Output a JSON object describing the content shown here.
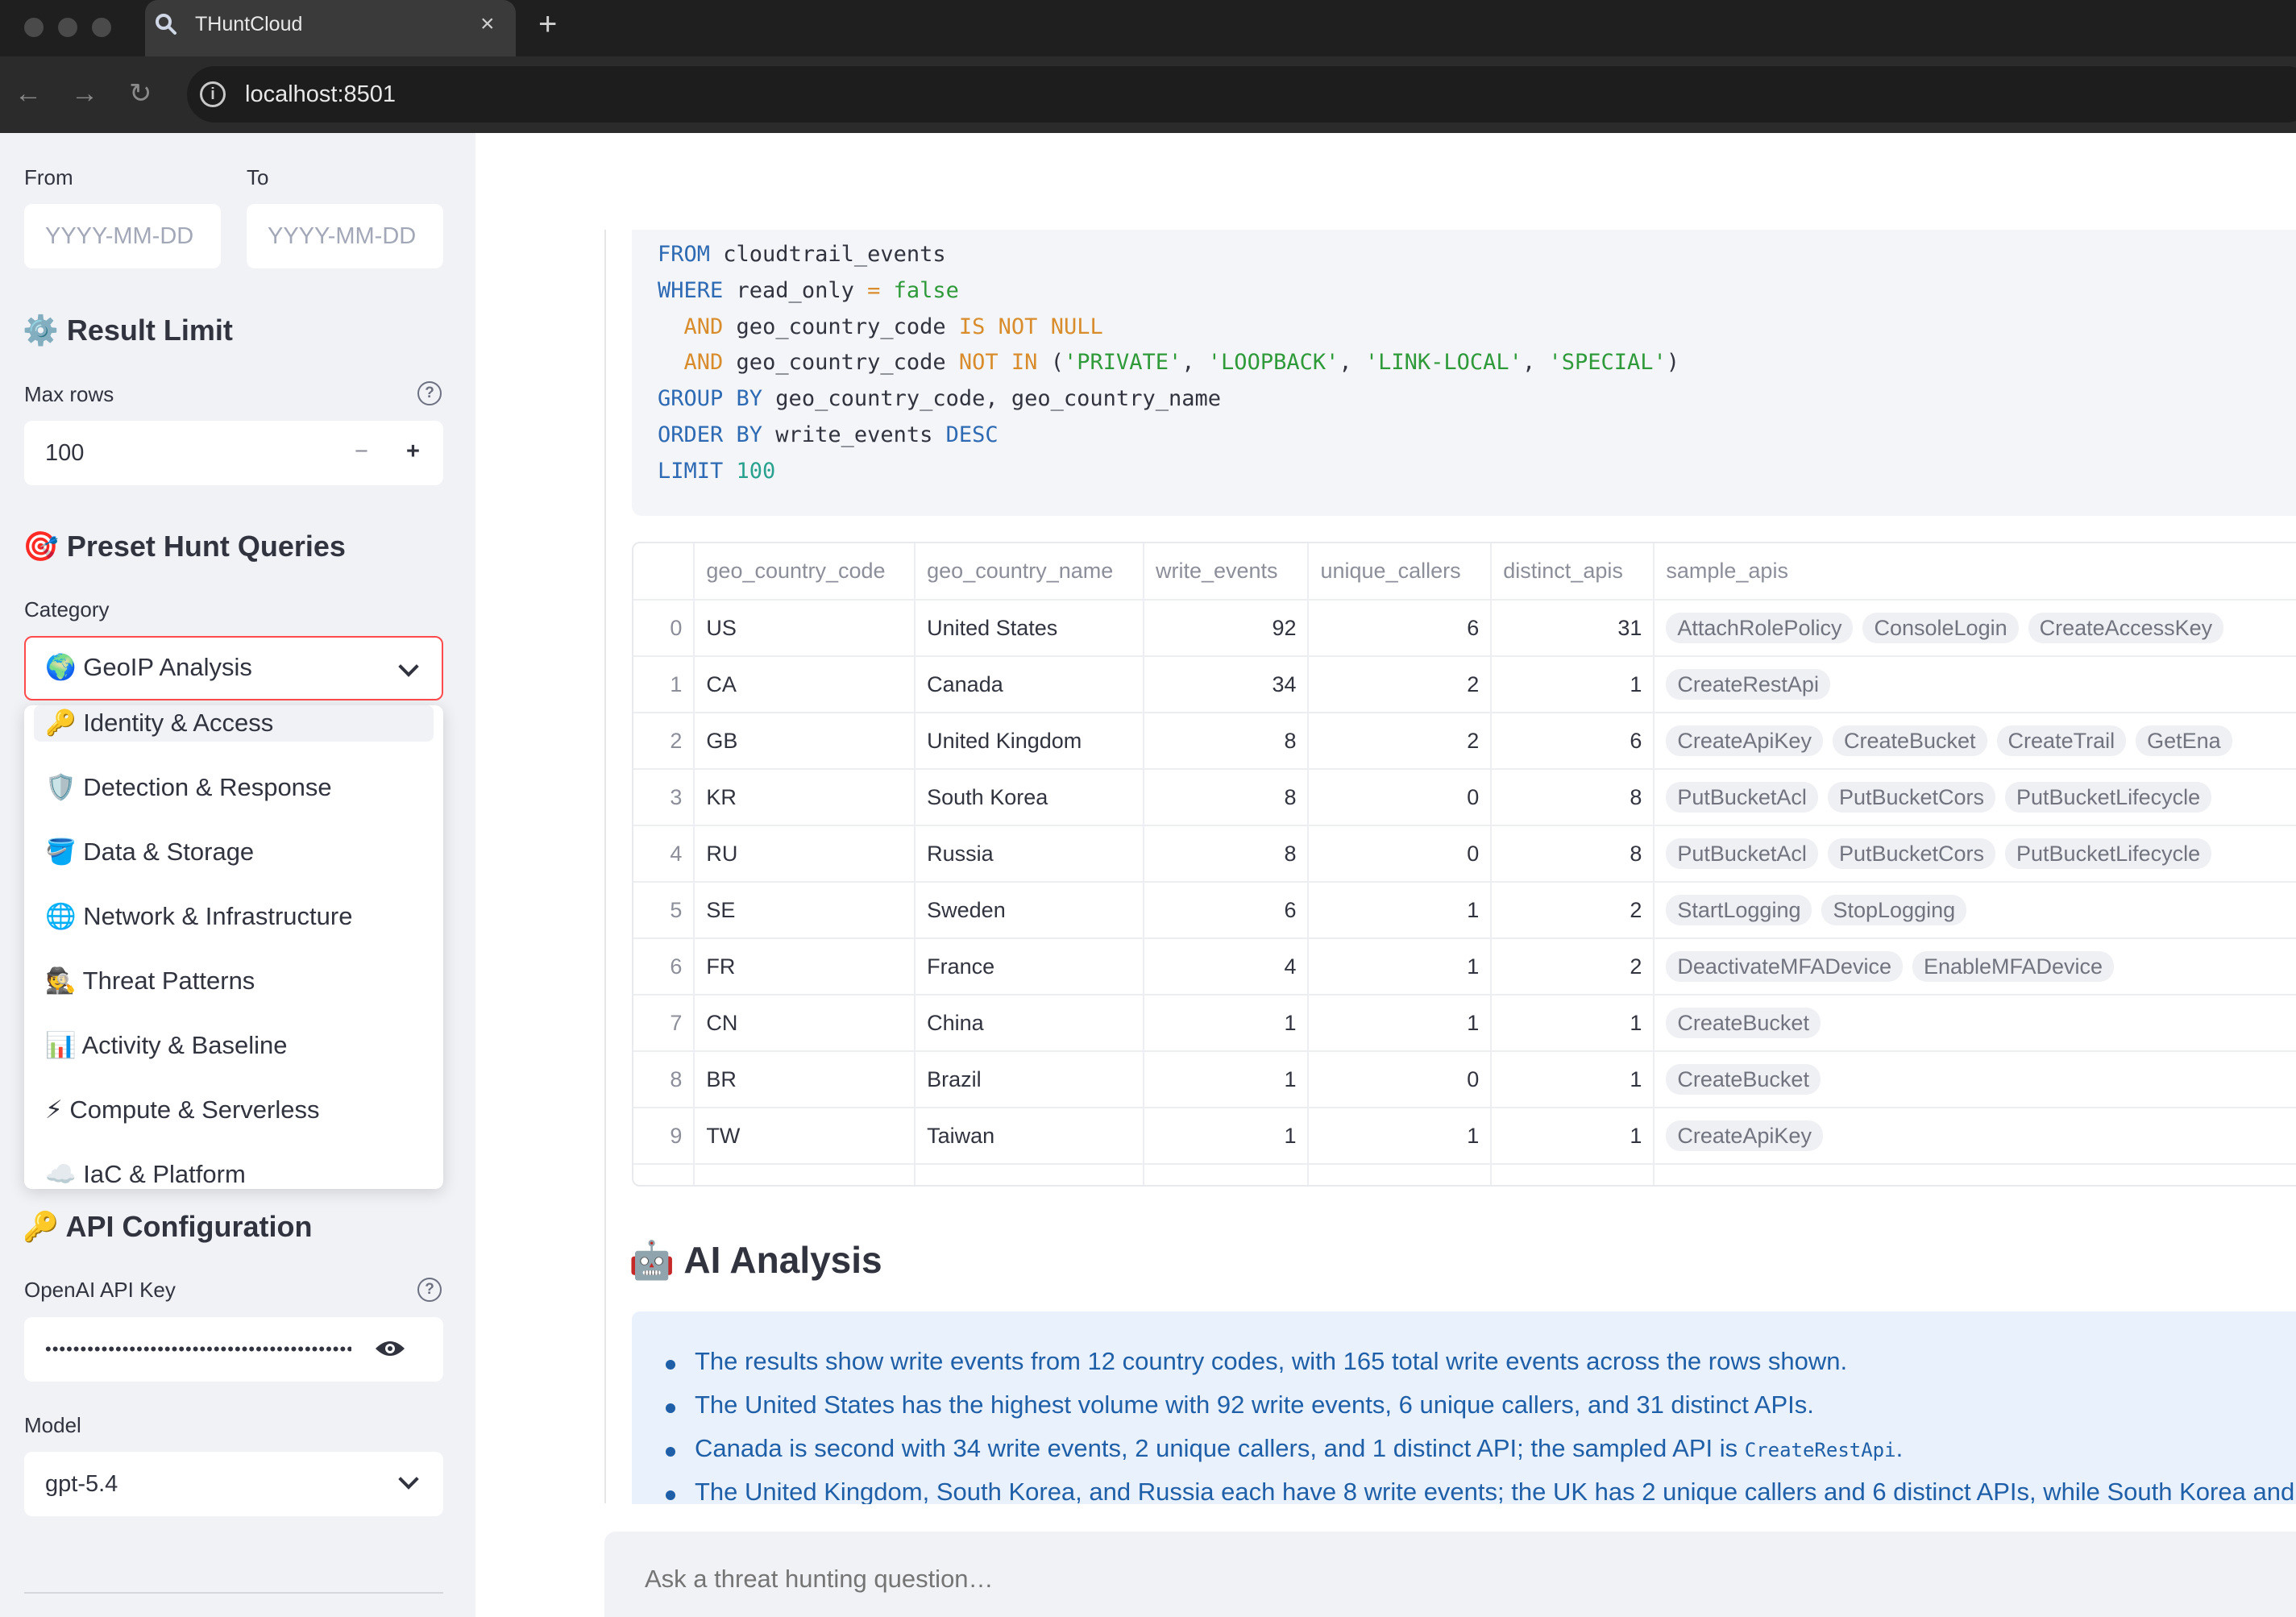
{
  "browser": {
    "tab_title": "THuntCloud",
    "tab_close": "×",
    "new_tab": "+",
    "url": "localhost:8501",
    "back": "←",
    "forward": "→",
    "reload": "↻",
    "info": "i"
  },
  "sidebar": {
    "from_label": "From",
    "to_label": "To",
    "date_placeholder": "YYYY-MM-DD",
    "result_limit_title": "⚙️ Result Limit",
    "max_rows_label": "Max rows",
    "max_rows_value": "100",
    "minus": "−",
    "plus": "+",
    "help": "?",
    "preset_title": "🎯 Preset Hunt Queries",
    "category_label": "Category",
    "category_selected": "🌍 GeoIP Analysis",
    "category_options": [
      "🔑 Identity & Access",
      "🛡️ Detection & Response",
      "🪣 Data & Storage",
      "🌐 Network & Infrastructure",
      "🕵️ Threat Patterns",
      "📊 Activity & Baseline",
      "⚡ Compute & Serverless",
      "☁️ IaC & Platform"
    ],
    "api_title": "🔑 API Configuration",
    "api_key_label": "OpenAI API Key",
    "api_key_value": "••••••••••••••••••••••••••••••••••••••••••••",
    "model_label": "Model",
    "model_value": "gpt-5.4",
    "eye": "👁"
  },
  "colors": {
    "accent_red": "#ff4b4b",
    "ai_text": "#1e5fa8",
    "sidebar_bg": "#f0f2f6"
  },
  "results": {
    "columns": [
      "",
      "geo_country_code",
      "geo_country_name",
      "write_events",
      "unique_callers",
      "distinct_apis",
      "sample_apis"
    ],
    "rows": [
      {
        "idx": "0",
        "code": "US",
        "name": "United States",
        "write_events": "92",
        "unique_callers": "6",
        "distinct_apis": "31",
        "apis": [
          "AttachRolePolicy",
          "ConsoleLogin",
          "CreateAccessKey"
        ]
      },
      {
        "idx": "1",
        "code": "CA",
        "name": "Canada",
        "write_events": "34",
        "unique_callers": "2",
        "distinct_apis": "1",
        "apis": [
          "CreateRestApi"
        ]
      },
      {
        "idx": "2",
        "code": "GB",
        "name": "United Kingdom",
        "write_events": "8",
        "unique_callers": "2",
        "distinct_apis": "6",
        "apis": [
          "CreateApiKey",
          "CreateBucket",
          "CreateTrail",
          "GetEna"
        ]
      },
      {
        "idx": "3",
        "code": "KR",
        "name": "South Korea",
        "write_events": "8",
        "unique_callers": "0",
        "distinct_apis": "8",
        "apis": [
          "PutBucketAcl",
          "PutBucketCors",
          "PutBucketLifecycle"
        ]
      },
      {
        "idx": "4",
        "code": "RU",
        "name": "Russia",
        "write_events": "8",
        "unique_callers": "0",
        "distinct_apis": "8",
        "apis": [
          "PutBucketAcl",
          "PutBucketCors",
          "PutBucketLifecycle"
        ]
      },
      {
        "idx": "5",
        "code": "SE",
        "name": "Sweden",
        "write_events": "6",
        "unique_callers": "1",
        "distinct_apis": "2",
        "apis": [
          "StartLogging",
          "StopLogging"
        ]
      },
      {
        "idx": "6",
        "code": "FR",
        "name": "France",
        "write_events": "4",
        "unique_callers": "1",
        "distinct_apis": "2",
        "apis": [
          "DeactivateMFADevice",
          "EnableMFADevice"
        ]
      },
      {
        "idx": "7",
        "code": "CN",
        "name": "China",
        "write_events": "1",
        "unique_callers": "1",
        "distinct_apis": "1",
        "apis": [
          "CreateBucket"
        ]
      },
      {
        "idx": "8",
        "code": "BR",
        "name": "Brazil",
        "write_events": "1",
        "unique_callers": "0",
        "distinct_apis": "1",
        "apis": [
          "CreateBucket"
        ]
      },
      {
        "idx": "9",
        "code": "TW",
        "name": "Taiwan",
        "write_events": "1",
        "unique_callers": "1",
        "distinct_apis": "1",
        "apis": [
          "CreateApiKey"
        ]
      }
    ]
  },
  "ai": {
    "title": "🤖 AI Analysis",
    "bullets": [
      "The results show write events from 12 country codes, with 165 total write events across the rows shown.",
      "The United States has the highest volume with 92 write events, 6 unique callers, and 31 distinct APIs.",
      "Canada is second with 34 write events, 2 unique callers, and 1 distinct API; the sampled API is ",
      "The United Kingdom, South Korea, and Russia each have 8 write events; the UK has 2 unique callers and 6 distinct APIs, while South Korea and Russia"
    ],
    "bullet3_code": "CreateRestApi",
    "bullet3_end": "."
  },
  "chat": {
    "placeholder": "Ask a threat hunting question…"
  }
}
